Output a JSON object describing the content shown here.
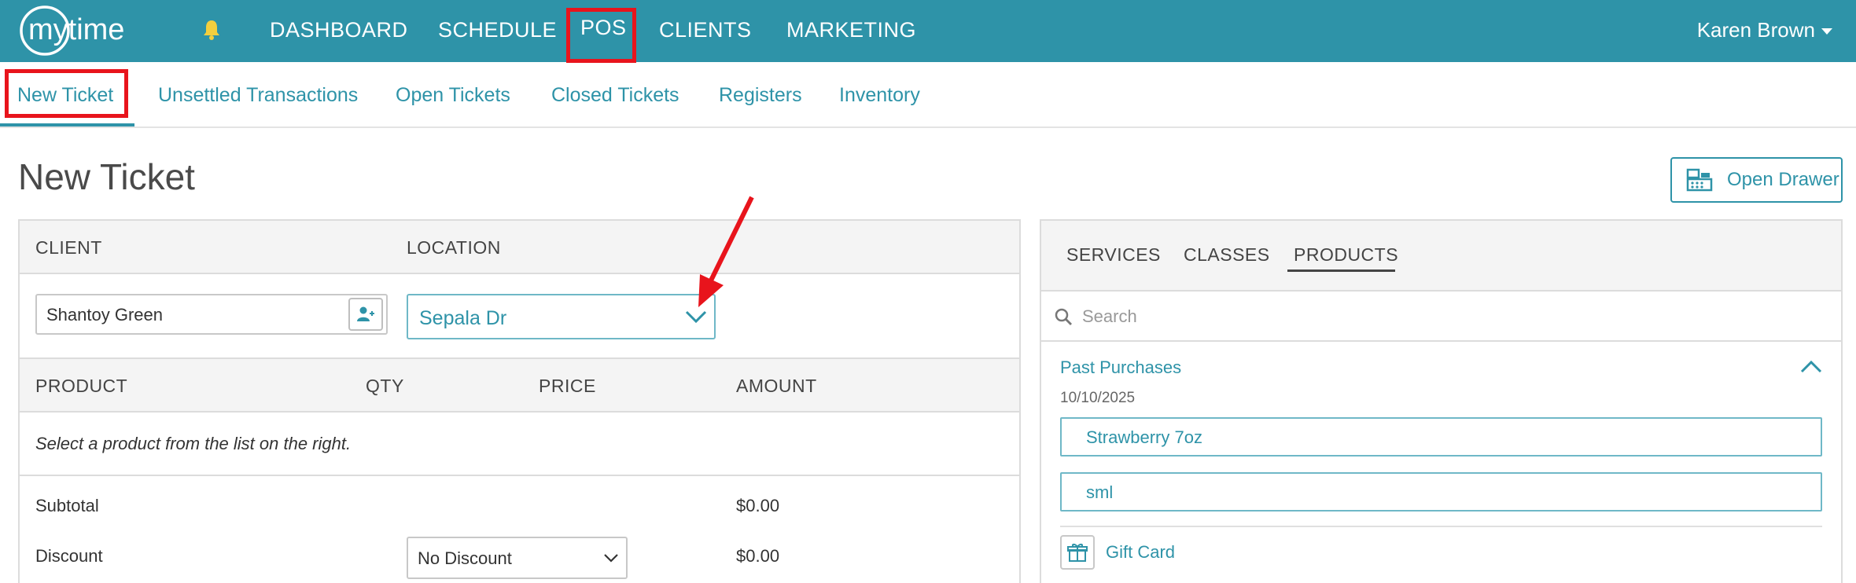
{
  "app": {
    "brand": "mytime"
  },
  "topnav": {
    "items": [
      {
        "label": "DASHBOARD"
      },
      {
        "label": "SCHEDULE"
      },
      {
        "label": "POS",
        "active": true
      },
      {
        "label": "CLIENTS"
      },
      {
        "label": "MARKETING"
      }
    ],
    "user": "Karen Brown"
  },
  "subnav": {
    "items": [
      {
        "label": "New Ticket",
        "active": true
      },
      {
        "label": "Unsettled Transactions"
      },
      {
        "label": "Open Tickets"
      },
      {
        "label": "Closed Tickets"
      },
      {
        "label": "Registers"
      },
      {
        "label": "Inventory"
      }
    ]
  },
  "page": {
    "title": "New Ticket",
    "open_drawer_label": "Open Drawer"
  },
  "ticket": {
    "client_label": "CLIENT",
    "location_label": "LOCATION",
    "client_value": "Shantoy Green",
    "location_value": "Sepala Dr",
    "columns": [
      "PRODUCT",
      "QTY",
      "PRICE",
      "AMOUNT"
    ],
    "empty_message": "Select a product from the list on the right.",
    "subtotal_label": "Subtotal",
    "subtotal_value": "$0.00",
    "discount_label": "Discount",
    "discount_value": "No Discount",
    "discount_amount": "$0.00"
  },
  "catalog": {
    "tabs": [
      {
        "label": "SERVICES"
      },
      {
        "label": "CLASSES"
      },
      {
        "label": "PRODUCTS",
        "active": true
      }
    ],
    "search_placeholder": "Search",
    "past_purchases_label": "Past Purchases",
    "past_purchase_date": "10/10/2025",
    "past_purchase_items": [
      {
        "label": "Strawberry 7oz"
      },
      {
        "label": "sml"
      }
    ],
    "gift_card_label": "Gift Card"
  },
  "colors": {
    "brand_teal": "#2e93a8",
    "highlight_red": "#e8141c"
  }
}
